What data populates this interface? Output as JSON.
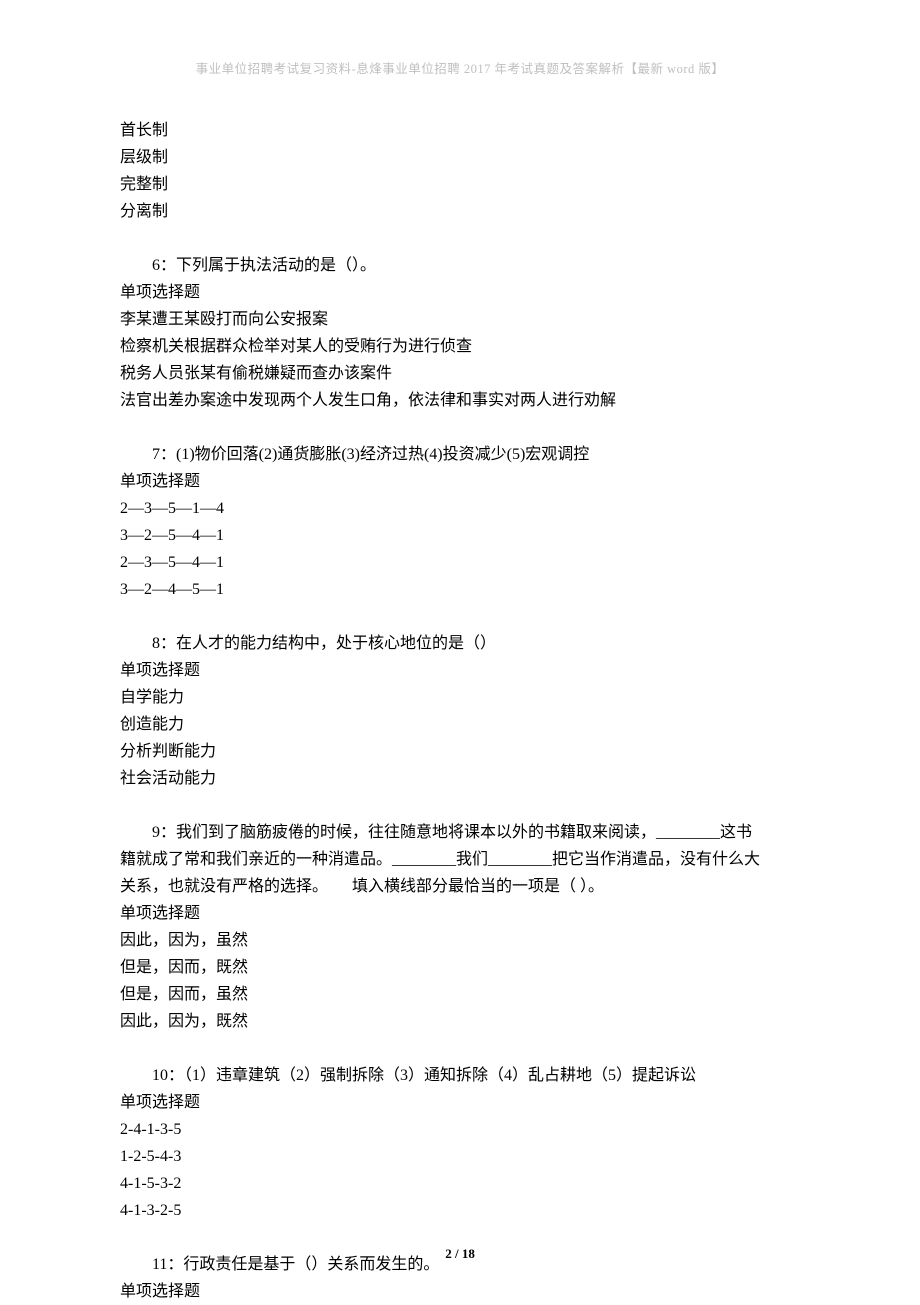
{
  "header": "事业单位招聘考试复习资料-息烽事业单位招聘 2017 年考试真题及答案解析【最新 word 版】",
  "q5": {
    "opts": [
      "首长制",
      "层级制",
      "完整制",
      "分离制"
    ]
  },
  "q6": {
    "line": "6：下列属于执法活动的是（）。",
    "type": "单项选择题",
    "opts": [
      "李某遭王某殴打而向公安报案",
      "检察机关根据群众检举对某人的受贿行为进行侦查",
      "税务人员张某有偷税嫌疑而查办该案件",
      "法官出差办案途中发现两个人发生口角，依法律和事实对两人进行劝解"
    ]
  },
  "q7": {
    "line": "7：(1)物价回落(2)通货膨胀(3)经济过热(4)投资减少(5)宏观调控",
    "type": "单项选择题",
    "opts": [
      "2—3—5—1—4",
      "3—2—5—4—1",
      "2—3—5—4—1",
      "3—2—4—5—1"
    ]
  },
  "q8": {
    "line": "8：在人才的能力结构中，处于核心地位的是（）",
    "type": "单项选择题",
    "opts": [
      "自学能力",
      "创造能力",
      "分析判断能力",
      "社会活动能力"
    ]
  },
  "q9": {
    "line1": "9：我们到了脑筋疲倦的时候，往往随意地将课本以外的书籍取来阅读，________这书",
    "line2": "籍就成了常和我们亲近的一种消遣品。________我们________把它当作消遣品，没有什么大",
    "line3": "关系，也就没有严格的选择。　　填入横线部分最恰当的一项是（  ）。",
    "type": "单项选择题",
    "opts": [
      "因此，因为，虽然",
      "但是，因而，既然",
      "但是，因而，虽然",
      "因此，因为，既然"
    ]
  },
  "q10": {
    "line": "10：（1）违章建筑（2）强制拆除（3）通知拆除（4）乱占耕地（5）提起诉讼",
    "type": "单项选择题",
    "opts": [
      "2-4-1-3-5",
      "1-2-5-4-3",
      "4-1-5-3-2",
      "4-1-3-2-5"
    ]
  },
  "q11": {
    "line": "11：行政责任是基于（）关系而发生的。",
    "type": "单项选择题"
  },
  "footer": {
    "page": "2",
    "sep": " / ",
    "total": "18"
  }
}
